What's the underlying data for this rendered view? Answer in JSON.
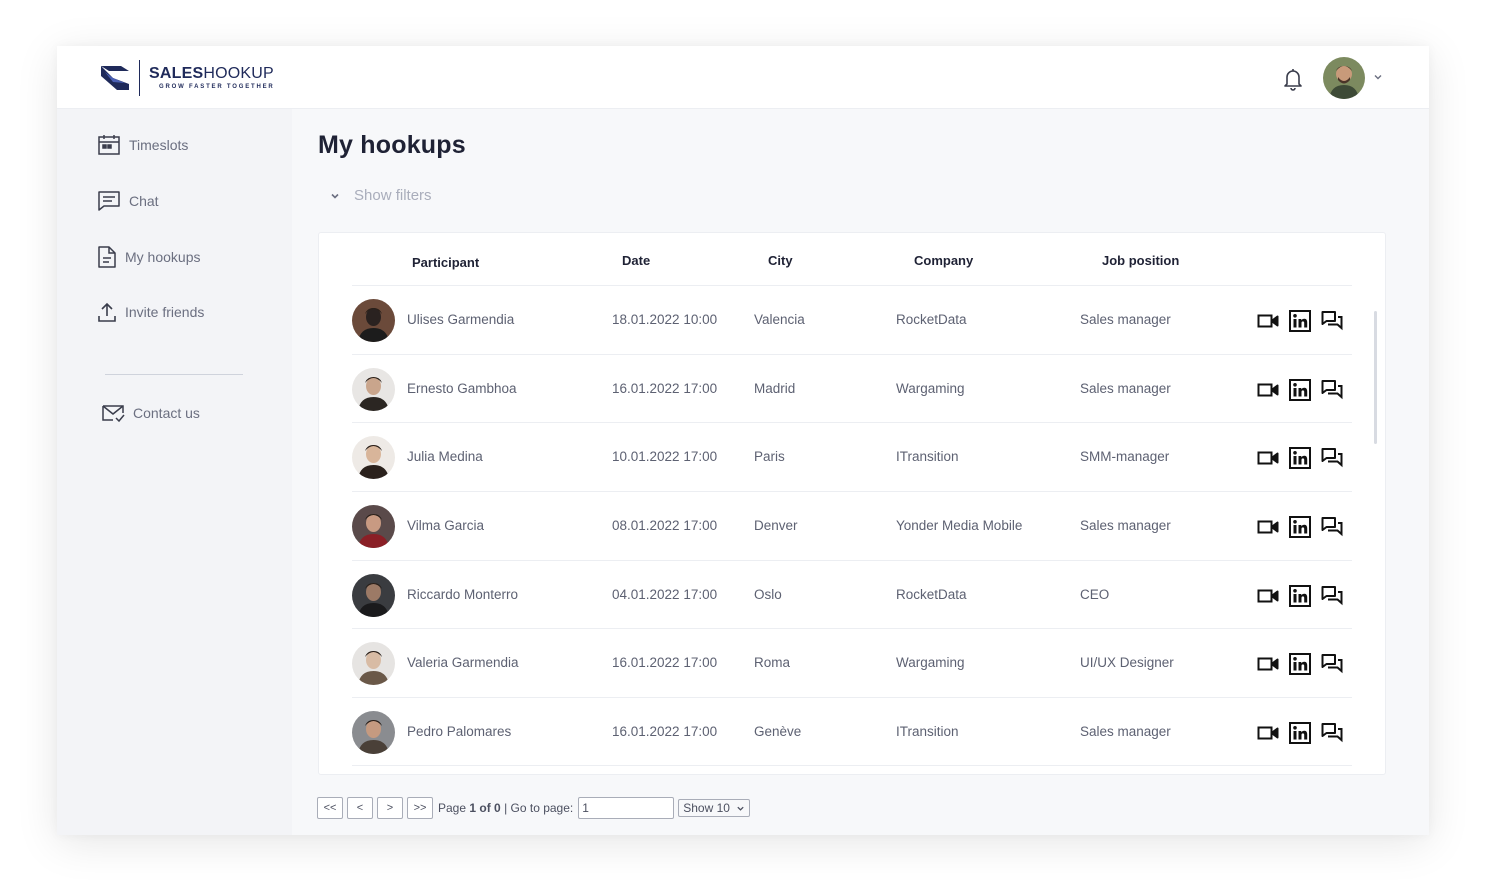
{
  "app": {
    "brand_bold": "SALES",
    "brand_light": "HOOKUP",
    "tagline": "GROW FASTER TOGETHER",
    "accent": "#1f2a5a"
  },
  "header": {
    "bell_icon": "bell-icon",
    "profile_chevron": "chevron-down-icon"
  },
  "sidebar": {
    "items": [
      {
        "label": "Timeslots",
        "icon": "calendar-icon"
      },
      {
        "label": "Chat",
        "icon": "chat-icon"
      },
      {
        "label": "My hookups",
        "icon": "document-icon"
      },
      {
        "label": "Invite friends",
        "icon": "upload-icon"
      }
    ],
    "contact": {
      "label": "Contact us",
      "icon": "mail-icon"
    }
  },
  "main": {
    "title": "My hookups",
    "filters_label": "Show filters"
  },
  "table": {
    "columns": [
      "Participant",
      "Date",
      "City",
      "Company",
      "Job position"
    ],
    "rows": [
      {
        "name": "Ulises Garmendia",
        "date": "18.01.2022 10:00",
        "city": "Valencia",
        "company": "RocketData",
        "position": "Sales manager"
      },
      {
        "name": "Ernesto Gambhoa",
        "date": "16.01.2022 17:00",
        "city": "Madrid",
        "company": "Wargaming",
        "position": "Sales manager"
      },
      {
        "name": "Julia Medina",
        "date": "10.01.2022 17:00",
        "city": "Paris",
        "company": "ITransition",
        "position": "SMM-manager"
      },
      {
        "name": "Vilma Garcia",
        "date": "08.01.2022 17:00",
        "city": "Denver",
        "company": "Yonder Media Mobile",
        "position": "Sales manager"
      },
      {
        "name": "Riccardo Monterro",
        "date": "04.01.2022 17:00",
        "city": "Oslo",
        "company": "RocketData",
        "position": "CEO"
      },
      {
        "name": "Valeria Garmendia",
        "date": "16.01.2022 17:00",
        "city": "Roma",
        "company": "Wargaming",
        "position": "UI/UX Designer"
      },
      {
        "name": "Pedro Palomares",
        "date": "16.01.2022 17:00",
        "city": "Genève",
        "company": "ITransition",
        "position": "Sales manager"
      }
    ],
    "row_actions": [
      "video-icon",
      "linkedin-icon",
      "chat-bubbles-icon"
    ]
  },
  "pagination": {
    "first": "<<",
    "prev": "<",
    "next": ">",
    "last": ">>",
    "page_prefix": "Page",
    "page_bold": "1 of 0",
    "goto_label": "| Go to page:",
    "goto_value": "1",
    "show_label": "Show 10"
  }
}
